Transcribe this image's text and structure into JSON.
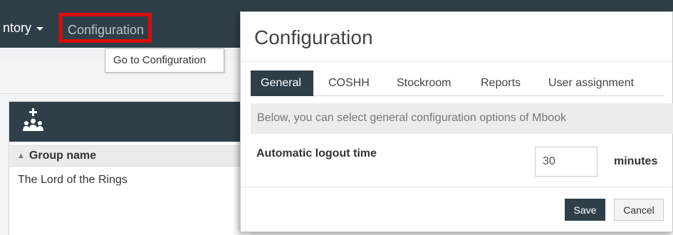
{
  "nav": {
    "inventory_label": "ntory",
    "configuration_label": "Configuration",
    "tooltip": "Go to Configuration"
  },
  "groups": {
    "column_header": "Group name",
    "rows": [
      "The Lord of the Rings"
    ]
  },
  "modal": {
    "title": "Configuration",
    "tabs": [
      {
        "label": "General",
        "active": true
      },
      {
        "label": "COSHH",
        "active": false
      },
      {
        "label": "Stockroom",
        "active": false
      },
      {
        "label": "Reports",
        "active": false
      },
      {
        "label": "User assignment",
        "active": false
      }
    ],
    "intro": "Below, you can select general configuration options of Mbook",
    "logout_label": "Automatic logout time",
    "logout_value": "30",
    "logout_unit": "minutes",
    "save_label": "Save",
    "cancel_label": "Cancel"
  },
  "colors": {
    "navbar": "#2f3f4a",
    "highlight": "#d70e0e"
  },
  "icons": {
    "group_add": "group-add-icon",
    "sort": "sort-up-icon",
    "dropdown": "caret-down-icon"
  }
}
